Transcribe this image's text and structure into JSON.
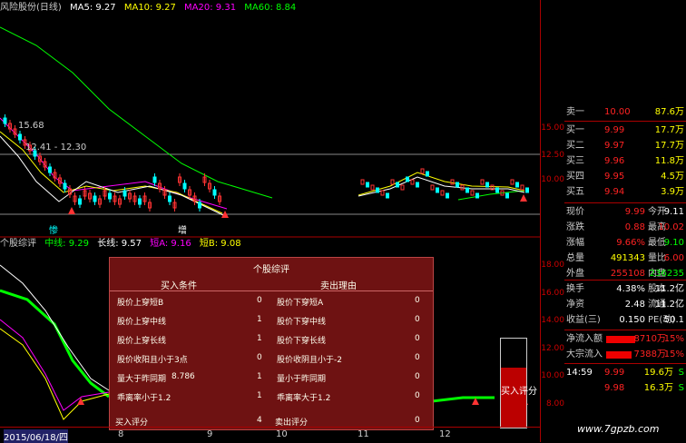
{
  "main_legend": {
    "title": "风险股份(日线)",
    "ma5": "MA5: 9.27",
    "ma10": "MA10: 9.27",
    "ma20": "MA20: 9.31",
    "ma60": "MA60: 8.84"
  },
  "price_annotations": {
    "high": "15.68",
    "range": "12.41 - 12.30"
  },
  "candle_markers": {
    "low_marker": "惨",
    "up_marker": "增"
  },
  "ind_legend": {
    "name": "个股综评",
    "short": "中线: 9.29",
    "long": "长线: 9.57",
    "shortA": "短A: 9.16",
    "shortB": "短B: 9.08"
  },
  "dialog": {
    "title": "个股综评",
    "buy_header": "买入条件",
    "sell_header": "卖出理由",
    "buy_rows": [
      {
        "label": "股价上穿短B",
        "extra": "",
        "value": "0"
      },
      {
        "label": "股价上穿中线",
        "extra": "",
        "value": "1"
      },
      {
        "label": "股价上穿长线",
        "extra": "",
        "value": "1"
      },
      {
        "label": "股价收阳且小于3点",
        "extra": "",
        "value": "0"
      },
      {
        "label": "量大于昨同期",
        "extra": "8.786",
        "value": "1"
      },
      {
        "label": "乖离率小于1.2",
        "extra": "",
        "value": "1"
      }
    ],
    "sell_rows": [
      {
        "label": "股价下穿短A",
        "value": "0"
      },
      {
        "label": "股价下穿中线",
        "value": "0"
      },
      {
        "label": "股价下穿长线",
        "value": "0"
      },
      {
        "label": "股价收阴且小于-2",
        "value": "0"
      },
      {
        "label": "量小于昨同期",
        "value": "0"
      },
      {
        "label": "乖离率大于1.2",
        "value": "0"
      }
    ],
    "buy_score_label": "买入评分",
    "buy_score": "4",
    "sell_score_label": "卖出评分",
    "sell_score": "0"
  },
  "buy_gauge": {
    "label": "买入评分",
    "fraction": 0.67
  },
  "date_axis": {
    "start": "2015/06/18/四",
    "ticks": [
      "8",
      "9",
      "10",
      "11",
      "12"
    ],
    "end": "日l"
  },
  "right_axis": {
    "main_ticks": [
      "15.00",
      "12.50",
      "10.00"
    ],
    "ind_ticks": [
      "18.00",
      "16.00",
      "14.00",
      "12.00",
      "10.00",
      "8.00"
    ]
  },
  "quote": {
    "asks": [
      {
        "label": "卖一",
        "price": "10.00",
        "vol": "87.6万"
      }
    ],
    "bids": [
      {
        "label": "买一",
        "price": "9.99",
        "vol": "17.7万"
      },
      {
        "label": "买二",
        "price": "9.97",
        "vol": "17.7万"
      },
      {
        "label": "买三",
        "price": "9.96",
        "vol": "11.8万"
      },
      {
        "label": "买四",
        "price": "9.95",
        "vol": "4.5万"
      },
      {
        "label": "买五",
        "price": "9.94",
        "vol": "3.9万"
      }
    ],
    "stats": [
      {
        "l1": "现价",
        "v1": "9.99",
        "c1": "red",
        "l2": "今开",
        "v2": "9.11",
        "c2": "white"
      },
      {
        "l1": "涨跌",
        "v1": "0.88",
        "c1": "red",
        "l2": "最高",
        "v2": "10.02",
        "c2": "red"
      },
      {
        "l1": "涨幅",
        "v1": "9.66%",
        "c1": "red",
        "l2": "最低",
        "v2": "9.10",
        "c2": "green"
      },
      {
        "l1": "总量",
        "v1": "491343",
        "c1": "yellow",
        "l2": "量比",
        "v2": "6.00",
        "c2": "red"
      },
      {
        "l1": "外盘",
        "v1": "255108",
        "c1": "red",
        "l2": "内盘",
        "v2": "236235",
        "c2": "green"
      }
    ],
    "fund": [
      {
        "l1": "换手",
        "v1": "4.38%",
        "l2": "股本",
        "v2": "11.2亿"
      },
      {
        "l1": "净资",
        "v1": "2.48",
        "l2": "流通",
        "v2": "11.2亿"
      },
      {
        "l1": "收益(三)",
        "v1": "0.150",
        "l2": "PE(动)",
        "v2": "50.1"
      }
    ],
    "flows": [
      {
        "label": "净流入额",
        "value": "8710万",
        "pct": "15%",
        "fill": 0.8
      },
      {
        "label": "大宗流入",
        "value": "7388万",
        "pct": "15%",
        "fill": 0.7
      }
    ],
    "ticks": [
      {
        "time": "14:59",
        "price": "9.99",
        "vol": "19.6万",
        "side": "S"
      },
      {
        "time": "",
        "price": "9.98",
        "vol": "16.3万",
        "side": "S"
      }
    ]
  },
  "watermark": "www.7gpzb.com",
  "colors": {
    "ma5": "#ffffff",
    "ma10": "#ffff00",
    "ma20": "#ff00ff",
    "ma60": "#00ff00",
    "up": "#ff3333",
    "down": "#00ffff",
    "panel_bg": "#6e1212"
  }
}
